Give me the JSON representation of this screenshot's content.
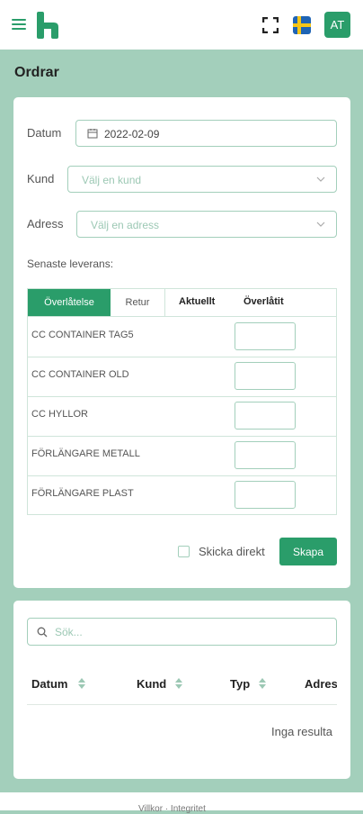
{
  "header": {
    "menu_icon": "hamburger-icon",
    "logo": "brand-logo",
    "fullscreen_icon": "fullscreen-icon",
    "language_flag": "sweden-flag",
    "avatar_initials": "AT"
  },
  "page": {
    "title": "Ordrar"
  },
  "form": {
    "date_label": "Datum",
    "date_value": "2022-02-09",
    "customer_label": "Kund",
    "customer_placeholder": "Välj en kund",
    "address_label": "Adress",
    "address_placeholder": "Välj en adress",
    "last_delivery_label": "Senaste leverans:",
    "tabs": {
      "active": "Överlåtelse",
      "second": "Retur"
    },
    "columns": {
      "current": "Aktuellt",
      "handed_over": "Överlåtit"
    },
    "products": [
      {
        "name": "CC CONTAINER TAG5"
      },
      {
        "name": "CC CONTAINER OLD"
      },
      {
        "name": "CC HYLLOR"
      },
      {
        "name": "FÖRLÄNGARE METALL"
      },
      {
        "name": "FÖRLÄNGARE PLAST"
      }
    ],
    "send_direct_label": "Skicka direkt",
    "create_button": "Skapa"
  },
  "list": {
    "search_placeholder": "Sök...",
    "columns": [
      "Datum",
      "Kund",
      "Typ",
      "Adres"
    ],
    "empty_text": "Inga resulta"
  },
  "footer": {
    "text": "Villkor · Integritet"
  },
  "colors": {
    "accent": "#2a9d6a",
    "background": "#a3cfbb",
    "border": "#a3cfbb"
  }
}
